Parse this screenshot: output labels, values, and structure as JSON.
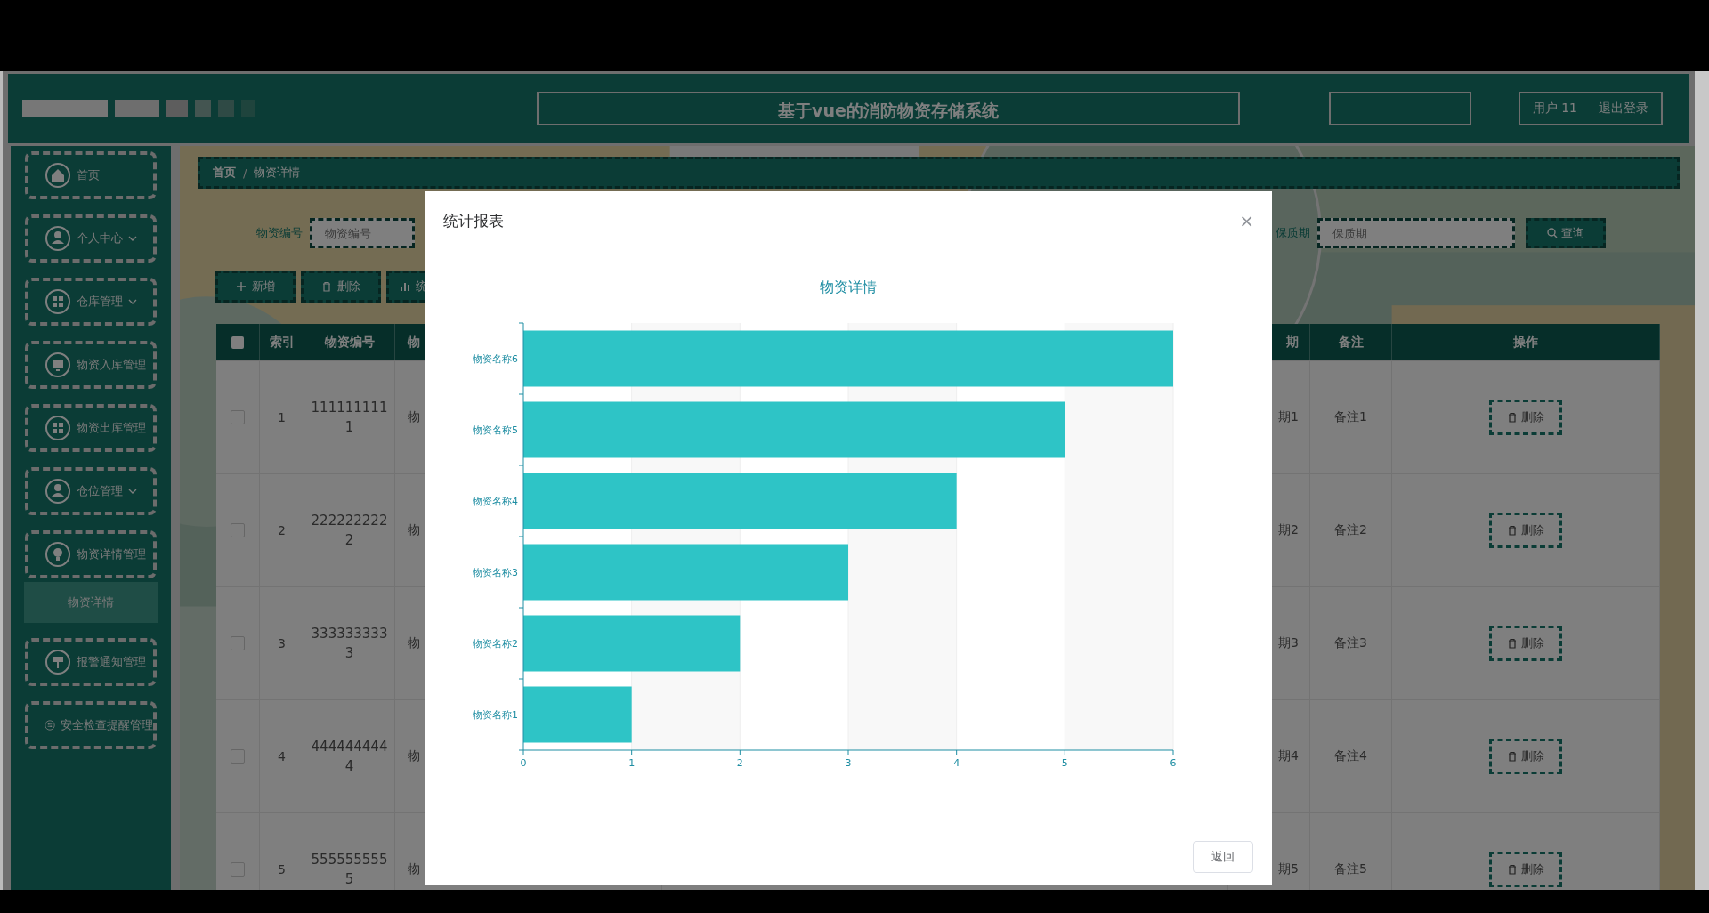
{
  "header": {
    "title": "基于vue的消防物资存储系统",
    "user": "用户 11",
    "logout": "退出登录"
  },
  "sidebar": {
    "items": [
      {
        "label": "首页",
        "kind": "link"
      },
      {
        "label": "个人中心",
        "kind": "submenu"
      },
      {
        "label": "仓库管理",
        "kind": "submenu"
      },
      {
        "label": "物资入库管理",
        "kind": "link"
      },
      {
        "label": "物资出库管理",
        "kind": "link"
      },
      {
        "label": "仓位管理",
        "kind": "submenu"
      },
      {
        "label": "物资详情管理",
        "kind": "link",
        "children": [
          {
            "label": "物资详情",
            "selected": true
          }
        ]
      },
      {
        "label": "报警通知管理",
        "kind": "link"
      },
      {
        "label": "安全检查提醒管理",
        "kind": "link"
      }
    ]
  },
  "breadcrumb": {
    "items": [
      "首页",
      "物资详情"
    ],
    "separator": "/"
  },
  "search": {
    "fields": [
      {
        "label": "物资编号",
        "placeholder": "物资编号"
      },
      {
        "label": "保质期",
        "placeholder": "保质期"
      }
    ],
    "button": "查询"
  },
  "select_all": {
    "checked": false
  },
  "actions": [
    {
      "label": "新增",
      "kind": "add"
    },
    {
      "label": "删除",
      "kind": "delete"
    },
    {
      "label": "统",
      "kind": "chart"
    }
  ],
  "table": {
    "columns": [
      "索引",
      "物资编号",
      "物",
      "期",
      "备注",
      "操作"
    ],
    "rows": [
      {
        "selected": false,
        "cells": [
          "1",
          "1111111111",
          "物",
          "期1",
          "备注1"
        ],
        "action": "删除"
      },
      {
        "selected": false,
        "cells": [
          "2",
          "2222222222",
          "物",
          "期2",
          "备注2"
        ],
        "action": "删除"
      },
      {
        "selected": false,
        "cells": [
          "3",
          "3333333333",
          "物",
          "期3",
          "备注3"
        ],
        "action": "删除"
      },
      {
        "selected": false,
        "cells": [
          "4",
          "4444444444",
          "物",
          "期4",
          "备注4"
        ],
        "action": "删除"
      },
      {
        "selected": false,
        "cells": [
          "5",
          "5555555555",
          "物",
          "期5",
          "备注5"
        ],
        "action": "删除"
      }
    ]
  },
  "dialog": {
    "title": "统计报表",
    "close": "×",
    "button": "返回",
    "chart_data": {
      "type": "bar",
      "orientation": "horizontal",
      "title": "物资详情",
      "categories": [
        "物资名称6",
        "物资名称5",
        "物资名称4",
        "物资名称3",
        "物资名称2",
        "物资名称1"
      ],
      "series": [
        {
          "color": "#2ec4c6",
          "values": [
            6,
            5,
            4,
            3,
            2,
            1
          ]
        }
      ],
      "xlim": [
        0,
        6
      ],
      "xticks": [
        0,
        1,
        2,
        3,
        4,
        5,
        6
      ],
      "grid": true
    }
  }
}
